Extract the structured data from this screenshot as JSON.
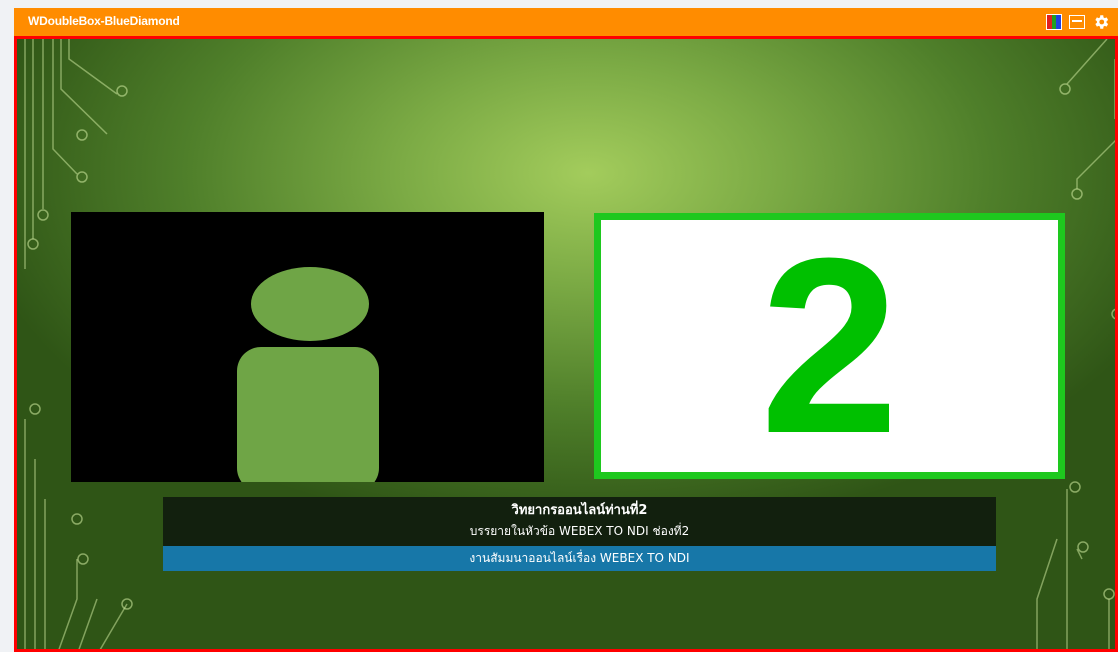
{
  "window": {
    "title": "WDoubleBox-BlueDiamond",
    "accent_color": "#ff8c00",
    "frame_color": "#ff0000",
    "toolbar_icons": [
      "color-bars-icon",
      "window-icon",
      "gear-icon"
    ]
  },
  "stage": {
    "camera": {
      "icon": "person-placeholder-icon",
      "background": "#000000"
    },
    "number_panel": {
      "value": "2",
      "color": "#00c000",
      "border_color": "#1ec81e"
    }
  },
  "lower_third": {
    "name": "วิทยากรออนไลน์ท่านที่2",
    "subtitle": "บรรยายในหัวข้อ  WEBEX TO NDI ช่องที่2",
    "event": "งานสัมมนาออนไลน์เรื่อง WEBEX TO NDI",
    "bar_color": "#1777a8"
  }
}
